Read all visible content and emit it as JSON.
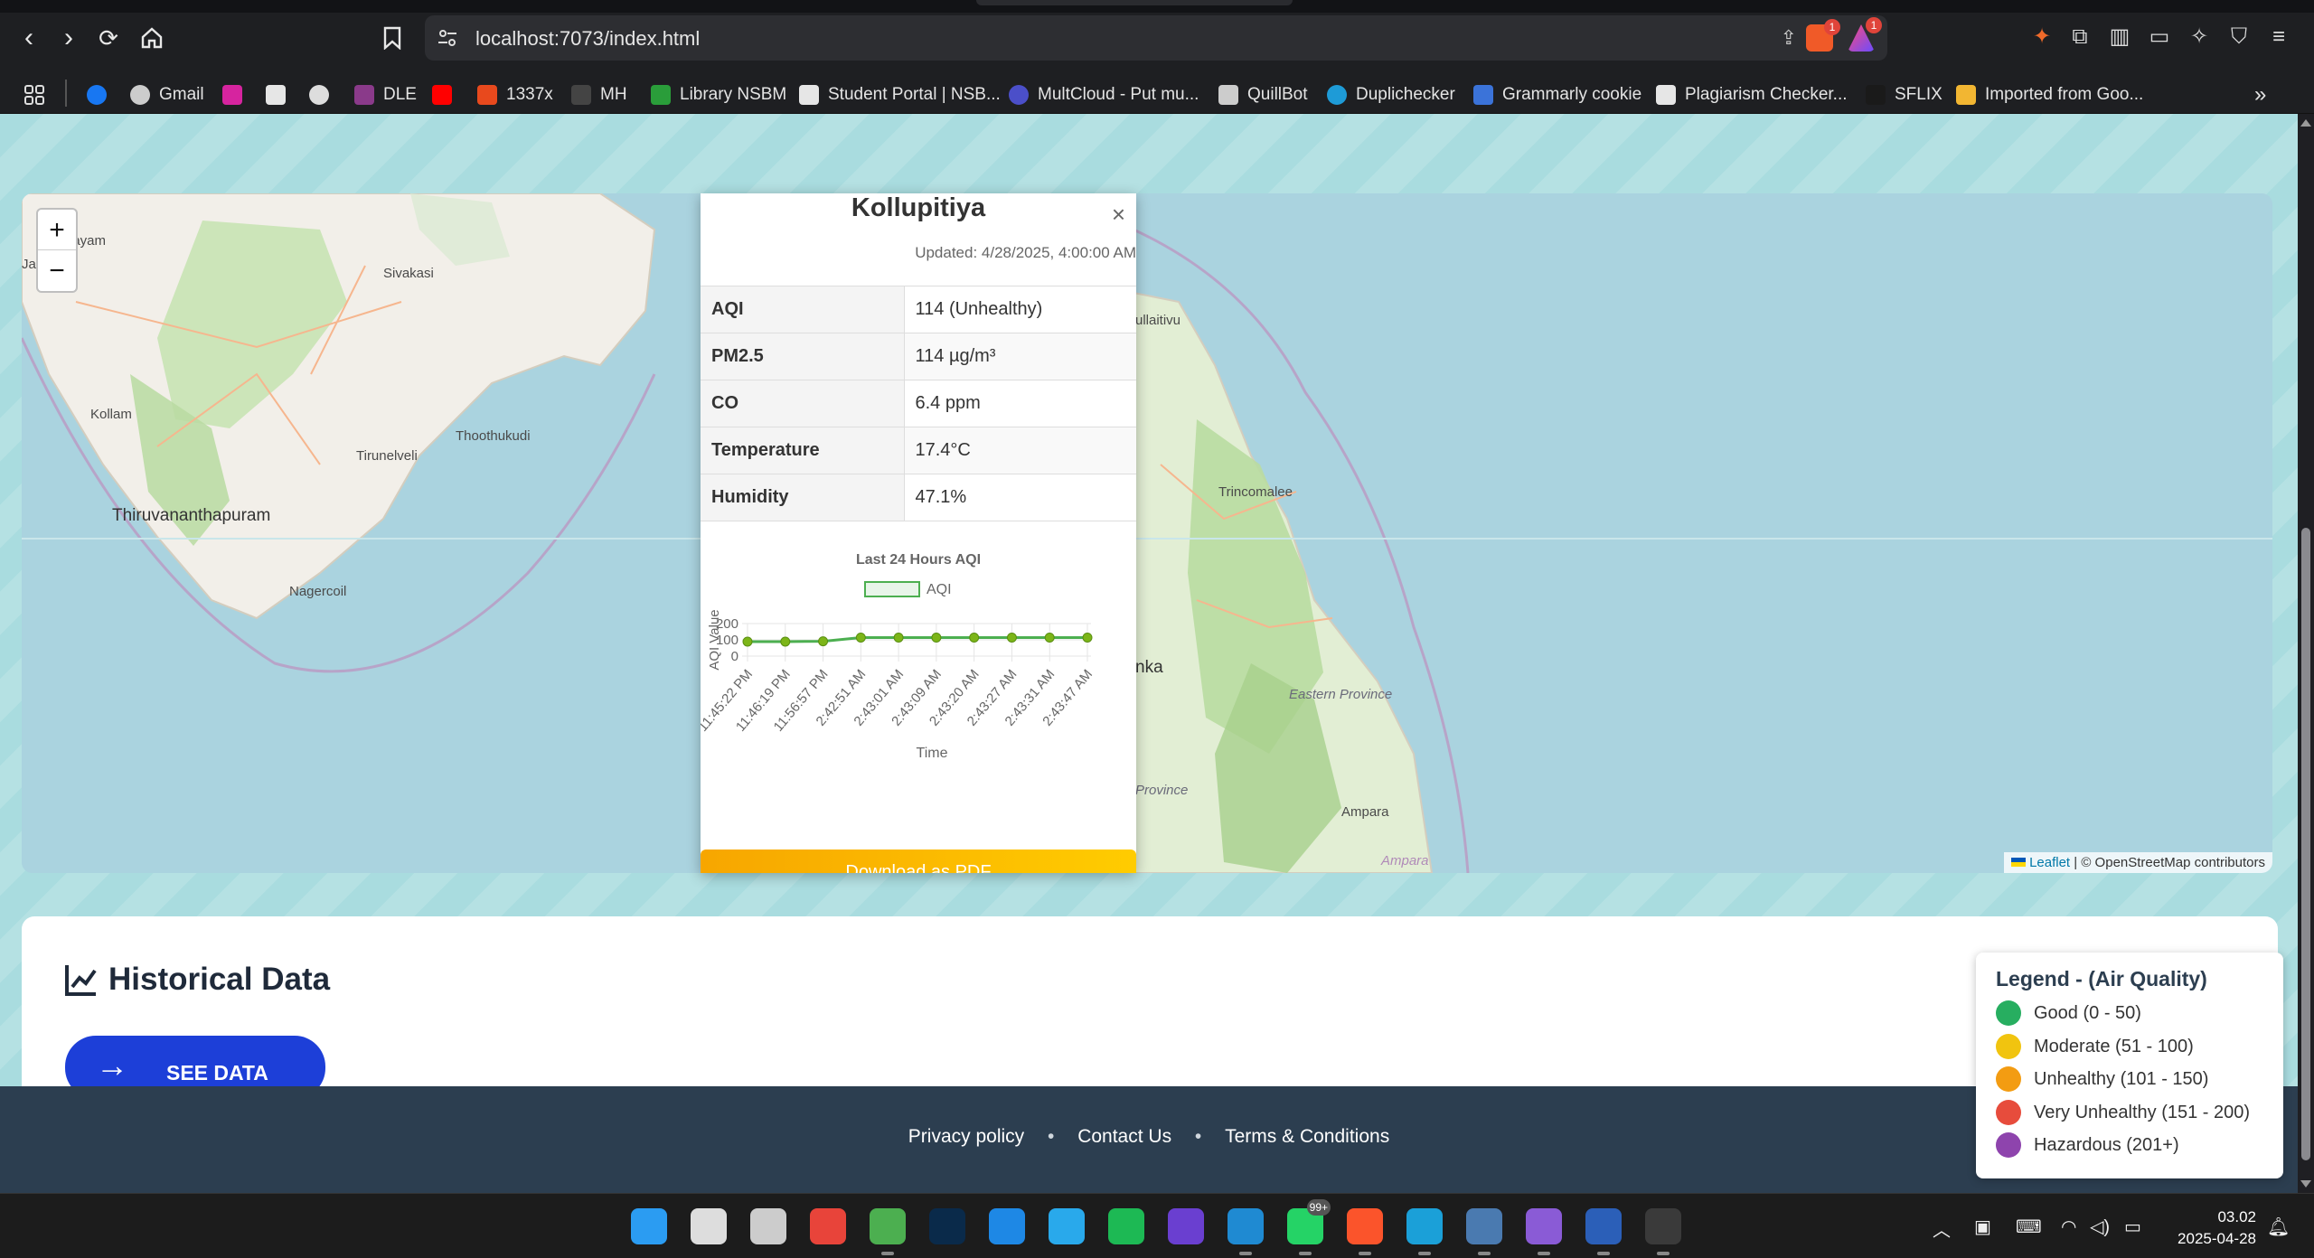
{
  "browser": {
    "url": "localhost:7073/index.html",
    "shield_badge": "1",
    "alert_badge": "1",
    "bookmarks": [
      {
        "label": "",
        "icon": "facebook-icon",
        "color": "#1877f2"
      },
      {
        "label": "Gmail",
        "icon": "globe-icon",
        "color": "#cccccc"
      },
      {
        "label": "",
        "icon": "instagram-icon",
        "color": "#d6249f"
      },
      {
        "label": "",
        "icon": "page-icon",
        "color": "#e6e6e6"
      },
      {
        "label": "",
        "icon": "chatgpt-icon",
        "color": "#dddddd"
      },
      {
        "label": "DLE",
        "icon": "shield-crest-icon",
        "color": "#8a3a8a"
      },
      {
        "label": "",
        "icon": "youtube-icon",
        "color": "#ff0000"
      },
      {
        "label": "1337x",
        "icon": "x-icon",
        "color": "#e8491d"
      },
      {
        "label": "MH",
        "icon": "m-icon",
        "color": "#444444"
      },
      {
        "label": "Library NSBM",
        "icon": "library-icon",
        "color": "#2a9d3a"
      },
      {
        "label": "Student Portal | NSB...",
        "icon": "portal-icon",
        "color": "#e6e6e6"
      },
      {
        "label": "MultCloud - Put mu...",
        "icon": "cloud-icon",
        "color": "#4b4fc9"
      },
      {
        "label": "QuillBot",
        "icon": "quill-icon",
        "color": "#cccccc"
      },
      {
        "label": "Duplichecker",
        "icon": "c-icon",
        "color": "#1e9bd7"
      },
      {
        "label": "Grammarly cookie",
        "icon": "info-icon",
        "color": "#3b73d9"
      },
      {
        "label": "Plagiarism Checker...",
        "icon": "sst-icon",
        "color": "#e6e6e6"
      },
      {
        "label": "SFLIX",
        "icon": "s-icon",
        "color": "#1a1a1a"
      },
      {
        "label": "Imported from Goo...",
        "icon": "folder-icon",
        "color": "#f2b632"
      }
    ]
  },
  "map": {
    "labels": {
      "kottayam": "ttayam",
      "sivakasi": "Sivakasi",
      "kollam": "Kollam",
      "tirunelveli": "Tirunelveli",
      "thoothukudi": "Thoothukudi",
      "thiruvananthapuram": "Thiruvananthapuram",
      "nagercoil": "Nagercoil",
      "mullaitivu": "ullaitivu",
      "trincomalee": "Trincomalee",
      "lanka": "nka",
      "eastern_province": "Eastern Province",
      "province": "Province",
      "ampara": "Ampara",
      "ampara2": "Ampara",
      "ja": "Ja"
    },
    "zoom_in": "+",
    "zoom_out": "−",
    "attribution_link": "Leaflet",
    "attribution_text": " | © OpenStreetMap contributors"
  },
  "popup": {
    "title": "Kollupitiya",
    "close": "×",
    "updated": "Updated: 4/28/2025, 4:00:00 AM",
    "rows": [
      {
        "key": "AQI",
        "value": "114 (Unhealthy)"
      },
      {
        "key": "PM2.5",
        "value": "114 µg/m³"
      },
      {
        "key": "CO",
        "value": "6.4 ppm"
      },
      {
        "key": "Temperature",
        "value": "17.4°C"
      },
      {
        "key": "Humidity",
        "value": "47.1%"
      }
    ],
    "pdf_button": "Download as PDF"
  },
  "chart_data": {
    "type": "line",
    "title": "Last 24 Hours AQI",
    "xlabel": "Time",
    "ylabel": "AQI Value",
    "ylim": [
      0,
      200
    ],
    "yticks": [
      0,
      100,
      200
    ],
    "categories": [
      "11:45:22 PM",
      "11:46:19 PM",
      "11:56:57 PM",
      "2:42:51 AM",
      "2:43:01 AM",
      "2:43:09 AM",
      "2:43:20 AM",
      "2:43:27 AM",
      "2:43:31 AM",
      "2:43:47 AM"
    ],
    "series": [
      {
        "name": "AQI",
        "values": [
          89,
          89,
          91,
          114,
          114,
          114,
          114,
          114,
          114,
          114
        ],
        "color": "#4caf50",
        "point_color": "#7cb518"
      }
    ],
    "legend": "top"
  },
  "historical": {
    "title": "Historical Data",
    "button": "SEE DATA"
  },
  "footer": {
    "links": [
      "Privacy policy",
      "Contact Us",
      "Terms & Conditions"
    ],
    "separator": "•"
  },
  "legend": {
    "title": "Legend - (Air Quality)",
    "items": [
      {
        "label": "Good (0 - 50)",
        "color": "#27ae60"
      },
      {
        "label": "Moderate (51 - 100)",
        "color": "#f1c40f"
      },
      {
        "label": "Unhealthy (101 - 150)",
        "color": "#f39c12"
      },
      {
        "label": "Very Unhealthy (151 - 200)",
        "color": "#e74c3c"
      },
      {
        "label": "Hazardous (201+)",
        "color": "#8e44ad"
      }
    ]
  },
  "taskbar": {
    "time": "03.02",
    "date": "2025-04-28",
    "whatsapp_badge": "99+",
    "apps": [
      {
        "icon": "windows-start-icon",
        "color": "#2b9cf2"
      },
      {
        "icon": "search-icon",
        "color": "#dddddd"
      },
      {
        "icon": "task-view-icon",
        "color": "#cccccc"
      },
      {
        "icon": "file-explorer-icon",
        "color": "#e8443a"
      },
      {
        "icon": "chrome-icon",
        "color": "#4caf50"
      },
      {
        "icon": "photoshop-icon",
        "color": "#0a2a4a"
      },
      {
        "icon": "outlook-icon",
        "color": "#1e88e5"
      },
      {
        "icon": "telegram-icon",
        "color": "#29a9eb"
      },
      {
        "icon": "spotify-icon",
        "color": "#1db954"
      },
      {
        "icon": "media-player-icon",
        "color": "#6a3fd0"
      },
      {
        "icon": "vscode-icon",
        "color": "#1f8ad2"
      },
      {
        "icon": "whatsapp-icon",
        "color": "#25d366"
      },
      {
        "icon": "brave-icon",
        "color": "#fb542b"
      },
      {
        "icon": "edge-icon",
        "color": "#1ba0d8"
      },
      {
        "icon": "postgres-icon",
        "color": "#4a7ab0"
      },
      {
        "icon": "visual-studio-icon",
        "color": "#8a5bd6"
      },
      {
        "icon": "word-icon",
        "color": "#2b5fb8"
      },
      {
        "icon": "terminal-icon",
        "color": "#3a3a3a"
      }
    ]
  }
}
